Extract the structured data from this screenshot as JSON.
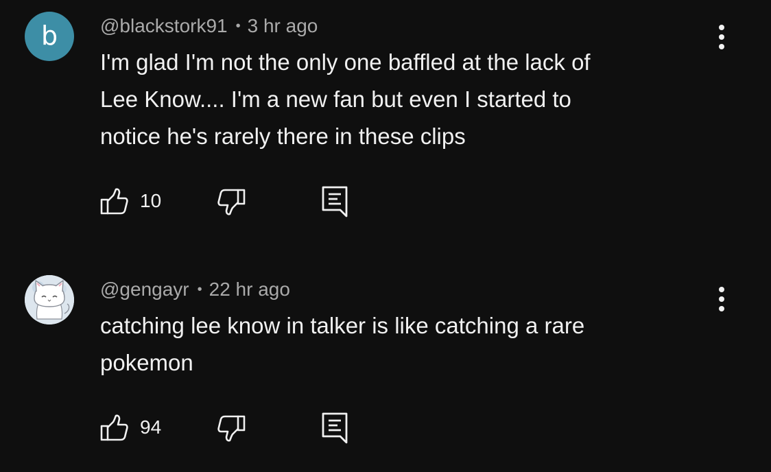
{
  "comments": [
    {
      "avatar_letter": "b",
      "avatar_color": "#3d8ea6",
      "author": "@blackstork91",
      "separator": "•",
      "time": "3 hr ago",
      "text_lines": [
        "I'm glad I'm not the only one baffled at the lack of",
        "Lee Know.... I'm a new fan but even I started to",
        "notice he's rarely there in these clips"
      ],
      "like_count": "10",
      "icons": {
        "like": "thumbs-up-icon",
        "dislike": "thumbs-down-icon",
        "reply": "reply-comment-icon",
        "more": "more-vertical-icon"
      }
    },
    {
      "avatar_image": "white cat illustration",
      "author": "@gengayr",
      "separator": "•",
      "time": "22 hr ago",
      "text_lines": [
        "catching lee know in talker is like catching a rare",
        "pokemon"
      ],
      "like_count": "94",
      "icons": {
        "like": "thumbs-up-icon",
        "dislike": "thumbs-down-icon",
        "reply": "reply-comment-icon",
        "more": "more-vertical-icon"
      }
    }
  ],
  "colors": {
    "background": "#0f0f0f",
    "text_primary": "#f1f1f1",
    "text_secondary": "#aaaaaa"
  }
}
